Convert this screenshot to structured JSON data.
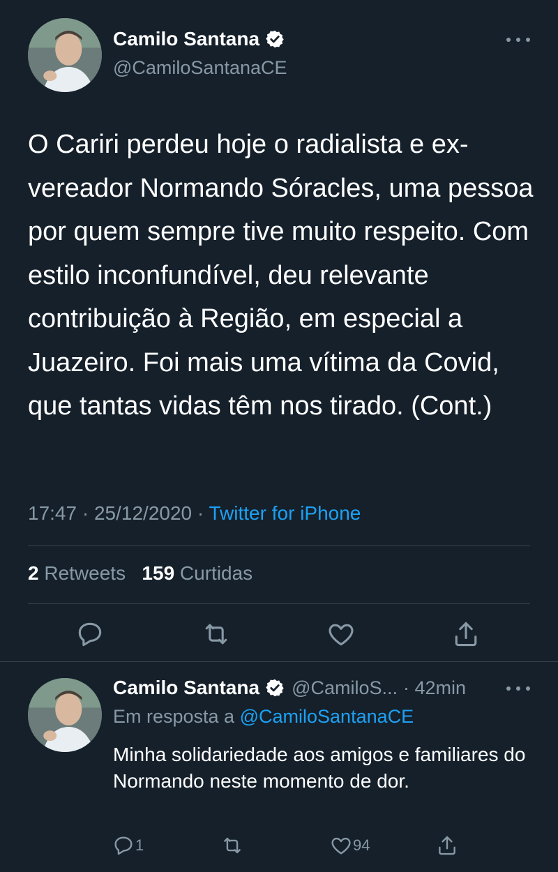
{
  "main_tweet": {
    "author_name": "Camilo Santana",
    "author_handle": "@CamiloSantanaCE",
    "verified_icon": "verified-badge-icon",
    "text": "O Cariri perdeu hoje o radialista e ex-vereador Normando Sóracles, uma pessoa por quem sempre tive muito respeito. Com estilo inconfundível, deu relevante contribuição à Região, em especial a Juazeiro. Foi mais uma vítima da Covid, que tantas vidas têm nos tirado. (Cont.)",
    "time": "17:47",
    "date": "25/12/2020",
    "separator": "·",
    "source": "Twitter for iPhone",
    "retweets_count": "2",
    "retweets_label": "Retweets",
    "likes_count": "159",
    "likes_label": "Curtidas"
  },
  "reply_tweet": {
    "author_name": "Camilo Santana",
    "author_handle": "@CamiloS...",
    "time_ago": "· 42min",
    "reply_prefix": "Em resposta a",
    "reply_handle": "@CamiloSantanaCE",
    "text": "Minha solidariedade aos amigos e familiares do Normando neste momento de dor.",
    "reply_count": "1",
    "like_count": "94"
  },
  "colors": {
    "background": "#15202b",
    "text_primary": "#ffffff",
    "text_secondary": "#8899a6",
    "accent": "#1da1f2",
    "divider": "#38444d"
  }
}
